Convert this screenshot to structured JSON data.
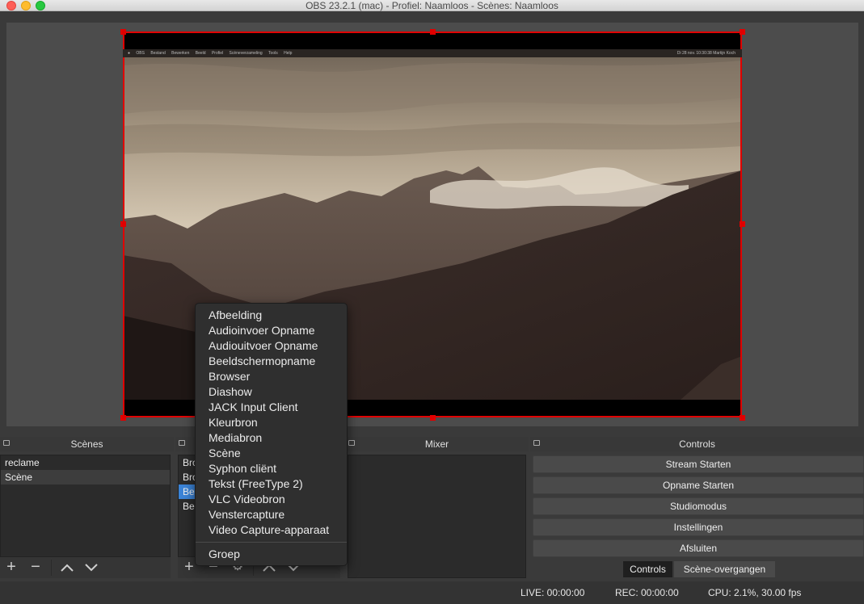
{
  "window": {
    "title": "OBS 23.2.1 (mac) - Profiel: Naamloos - Scènes: Naamloos"
  },
  "preview_capture": {
    "menubar_items": [
      "OBS",
      "Bestand",
      "Bewerken",
      "Beeld",
      "Profiel",
      "Scèneverzameling",
      "Tools",
      "Help"
    ],
    "menubar_right": "Di 28 nov. 10:30:38   Martijn Koch"
  },
  "scenes": {
    "title": "Scènes",
    "items": [
      "reclame",
      "Scène"
    ],
    "selected_index": 1
  },
  "sources": {
    "items": [
      "Bro",
      "Bro",
      "Be",
      "Be"
    ],
    "selected_index": 2
  },
  "mixer": {
    "title": "Mixer"
  },
  "controls": {
    "title": "Controls",
    "buttons": [
      "Stream Starten",
      "Opname Starten",
      "Studiomodus",
      "Instellingen",
      "Afsluiten"
    ],
    "tabs": [
      "Controls",
      "Scène-overgangen"
    ]
  },
  "context_menu": {
    "items": [
      "Afbeelding",
      "Audioinvoer Opname",
      "Audiouitvoer Opname",
      "Beeldschermopname",
      "Browser",
      "Diashow",
      "JACK Input Client",
      "Kleurbron",
      "Mediabron",
      "Scène",
      "Syphon cliënt",
      "Tekst (FreeType 2)",
      "VLC Videobron",
      "Venstercapture",
      "Video Capture-apparaat"
    ],
    "group_item": "Groep"
  },
  "status": {
    "live": "LIVE: 00:00:00",
    "rec": "REC: 00:00:00",
    "cpu": "CPU: 2.1%, 30.00 fps"
  },
  "colors": {
    "selection_border": "#e00000",
    "highlight": "#3b83d6",
    "background": "#3a3a3a"
  },
  "icons": [
    "plus-icon",
    "minus-icon",
    "chevron-up-icon",
    "chevron-down-icon",
    "gear-icon",
    "dock-float-icon"
  ]
}
